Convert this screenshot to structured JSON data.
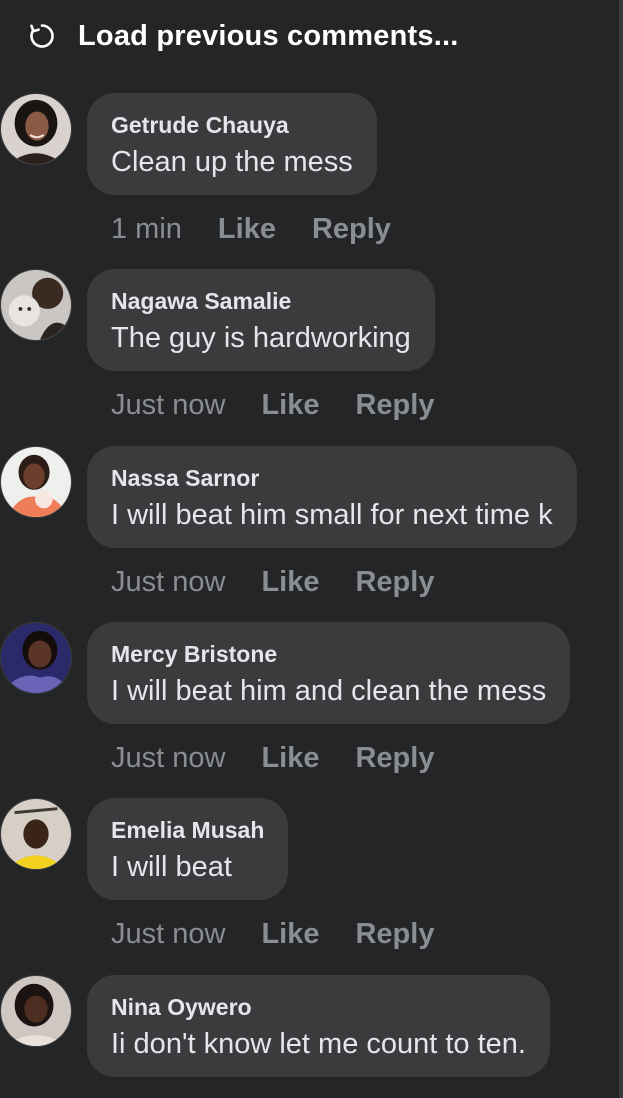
{
  "header": {
    "load_previous_label": "Load previous comments..."
  },
  "colors": {
    "background": "#242526",
    "bubble": "#3a3b3c",
    "primary_text": "#e4e6eb",
    "secondary_text": "#8a8d91"
  },
  "comments": [
    {
      "author": "Getrude Chauya",
      "text": "Clean up the mess",
      "time": "1 min",
      "like": "Like",
      "reply": "Reply"
    },
    {
      "author": "Nagawa Samalie",
      "text": "The guy is hardworking",
      "time": "Just now",
      "like": "Like",
      "reply": "Reply"
    },
    {
      "author": "Nassa Sarnor",
      "text": "I will beat him small for next time k",
      "time": "Just now",
      "like": "Like",
      "reply": "Reply"
    },
    {
      "author": "Mercy Bristone",
      "text": "I will beat him and clean the mess",
      "time": "Just now",
      "like": "Like",
      "reply": "Reply"
    },
    {
      "author": "Emelia Musah",
      "text": "I will beat",
      "time": "Just now",
      "like": "Like",
      "reply": "Reply"
    },
    {
      "author": "Nina Oywero",
      "text": "Ii don't know let me  count to ten.",
      "time": "",
      "like": "",
      "reply": ""
    }
  ]
}
